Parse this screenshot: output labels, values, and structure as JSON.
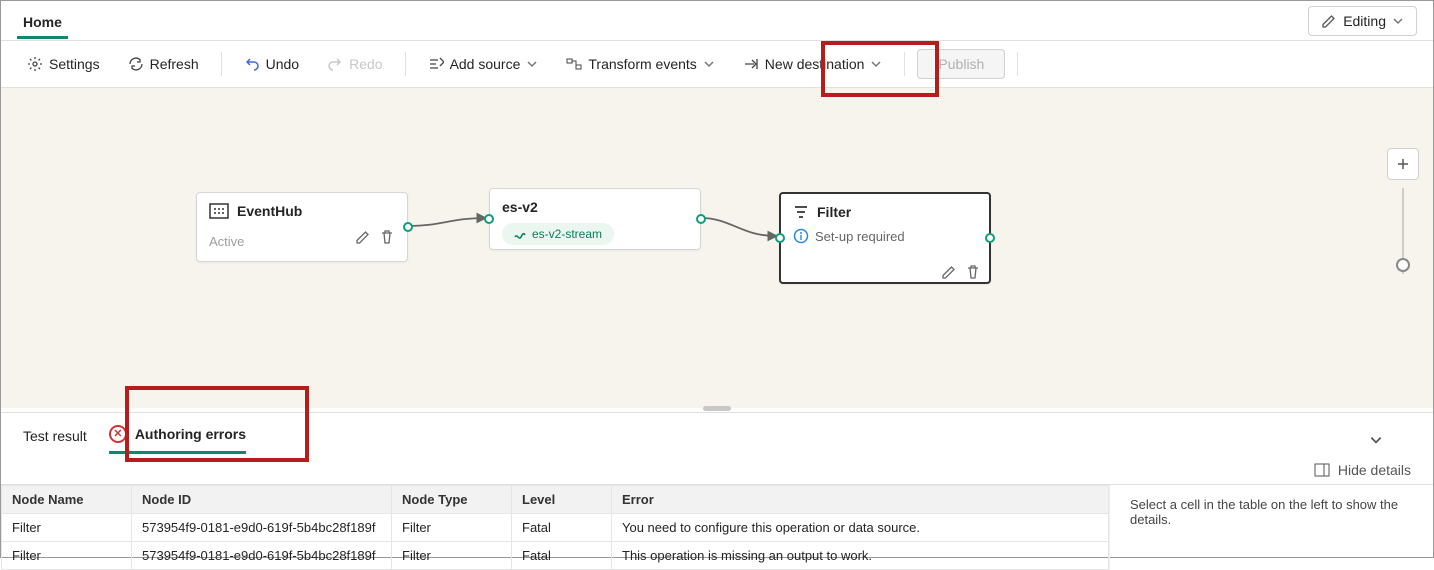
{
  "header": {
    "active_tab": "Home",
    "editing_label": "Editing"
  },
  "toolbar": {
    "settings": "Settings",
    "refresh": "Refresh",
    "undo": "Undo",
    "redo": "Redo",
    "add_source": "Add source",
    "transform_events": "Transform events",
    "new_destination": "New destination",
    "publish": "Publish"
  },
  "canvas": {
    "nodes": {
      "eventhub": {
        "title": "EventHub",
        "status": "Active"
      },
      "esv2": {
        "title": "es-v2",
        "stream": "es-v2-stream"
      },
      "filter": {
        "title": "Filter",
        "status": "Set-up required"
      }
    }
  },
  "bottom": {
    "tabs": {
      "test_result": "Test result",
      "authoring_errors": "Authoring errors"
    },
    "hide_details": "Hide details",
    "detail_hint": "Select a cell in the table on the left to show the details.",
    "table": {
      "headers": {
        "node_name": "Node Name",
        "node_id": "Node ID",
        "node_type": "Node Type",
        "level": "Level",
        "error": "Error"
      },
      "rows": [
        {
          "node_name": "Filter",
          "node_id": "573954f9-0181-e9d0-619f-5b4bc28f189f",
          "node_type": "Filter",
          "level": "Fatal",
          "error": "You need to configure this operation or data source."
        },
        {
          "node_name": "Filter",
          "node_id": "573954f9-0181-e9d0-619f-5b4bc28f189f",
          "node_type": "Filter",
          "level": "Fatal",
          "error": "This operation is missing an output to work."
        }
      ]
    }
  }
}
